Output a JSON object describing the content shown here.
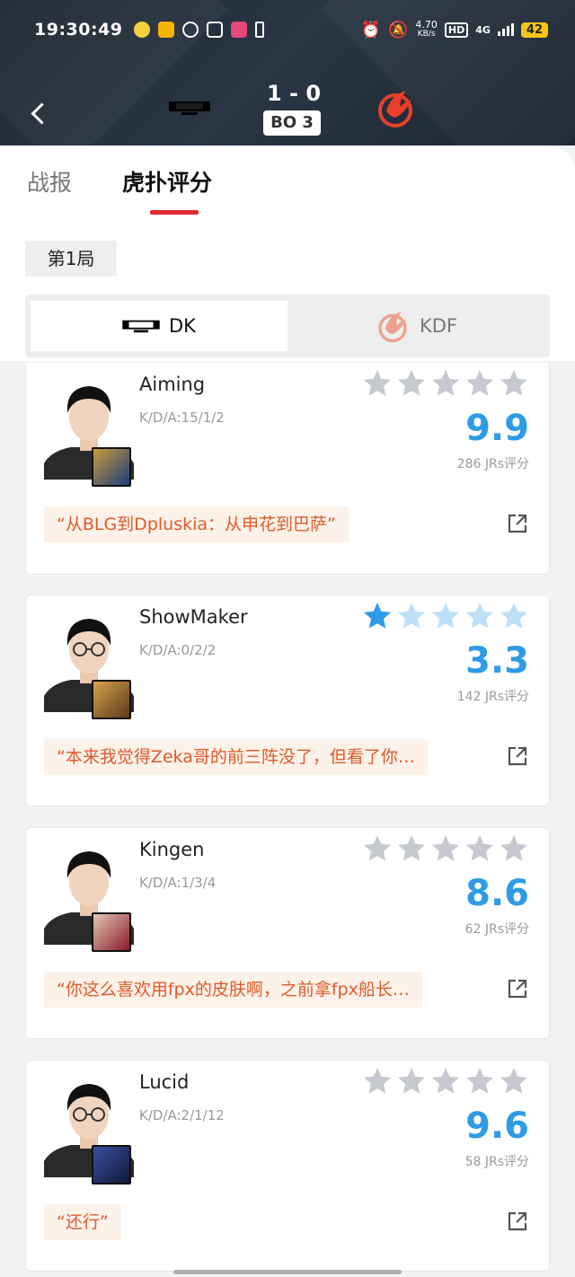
{
  "status_bar": {
    "time": "19:30:49",
    "net_speed_value": "4.70",
    "net_speed_unit": "KB/s",
    "hd": "HD",
    "network": "4G",
    "battery": "42"
  },
  "match": {
    "score": "1 - 0",
    "format": "BO 3"
  },
  "tabs": [
    {
      "label": "战报",
      "active": false
    },
    {
      "label": "虎扑评分",
      "active": true
    }
  ],
  "game_label": "第1局",
  "team_switch": {
    "left": "DK",
    "right": "KDF"
  },
  "colors": {
    "accent_red": "#e02a2f",
    "score_blue": "#2e9be6",
    "quote_orange": "#e05a2a"
  },
  "players": [
    {
      "name": "Aiming",
      "kda": "K/D/A:15/1/2",
      "filled_stars": 0,
      "rating": "9.9",
      "votes": "286 JRs评分",
      "quote": "“从BLG到Dpluskia：从申花到巴萨”"
    },
    {
      "name": "ShowMaker",
      "kda": "K/D/A:0/2/2",
      "filled_stars": 1,
      "rating": "3.3",
      "votes": "142 JRs评分",
      "quote": "“本来我觉得Zeka哥的前三阵没了，但看了你…"
    },
    {
      "name": "Kingen",
      "kda": "K/D/A:1/3/4",
      "filled_stars": 0,
      "rating": "8.6",
      "votes": "62 JRs评分",
      "quote": "“你这么喜欢用fpx的皮肤啊，之前拿fpx船长…"
    },
    {
      "name": "Lucid",
      "kda": "K/D/A:2/1/12",
      "filled_stars": 0,
      "rating": "9.6",
      "votes": "58 JRs评分",
      "quote": "“还行”"
    }
  ]
}
